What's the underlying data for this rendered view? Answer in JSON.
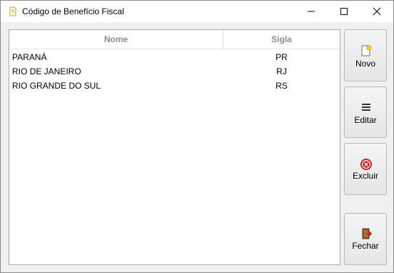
{
  "window": {
    "title": "Código de Benefício Fiscal",
    "icons": {
      "app": "document-icon",
      "minimize": "minimize-icon",
      "maximize": "maximize-icon",
      "close": "close-icon"
    }
  },
  "table": {
    "columns": [
      "Nome",
      "Sigla"
    ],
    "rows": [
      {
        "nome": "PARANÁ",
        "sigla": "PR"
      },
      {
        "nome": "RIO DE JANEIRO",
        "sigla": "RJ"
      },
      {
        "nome": "RIO GRANDE DO SUL",
        "sigla": "RS"
      }
    ]
  },
  "buttons": {
    "novo": {
      "label": "Novo",
      "icon": "new-document-icon"
    },
    "editar": {
      "label": "Editar",
      "icon": "list-icon"
    },
    "excluir": {
      "label": "Excluir",
      "icon": "delete-icon"
    },
    "fechar": {
      "label": "Fechar",
      "icon": "exit-door-icon"
    }
  },
  "colors": {
    "header_text": "#8d8d8d",
    "delete_red": "#d32020",
    "new_yellow": "#f2d13a"
  }
}
